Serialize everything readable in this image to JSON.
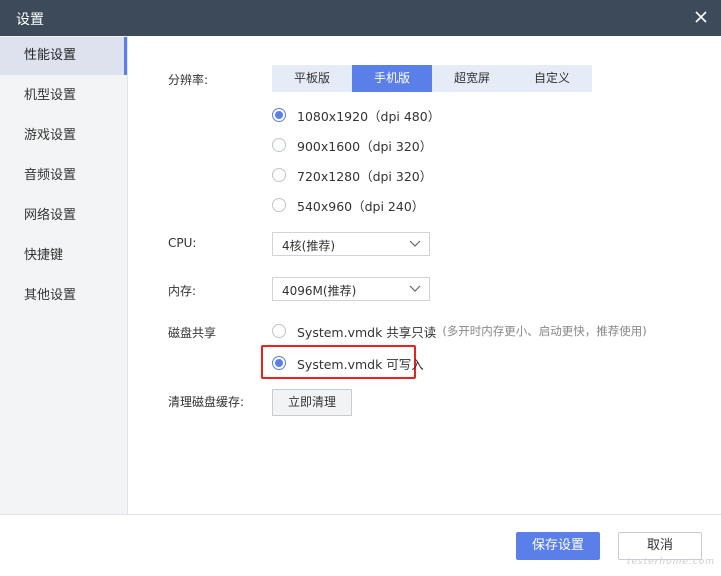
{
  "window": {
    "title": "设置"
  },
  "sidebar": {
    "items": [
      {
        "label": "性能设置",
        "active": true
      },
      {
        "label": "机型设置"
      },
      {
        "label": "游戏设置"
      },
      {
        "label": "音频设置"
      },
      {
        "label": "网络设置"
      },
      {
        "label": "快捷键"
      },
      {
        "label": "其他设置"
      }
    ]
  },
  "resolution": {
    "label": "分辨率:",
    "tabs": [
      "平板版",
      "手机版",
      "超宽屏",
      "自定义"
    ],
    "active_tab": "手机版",
    "options": [
      "1080x1920（dpi 480）",
      "900x1600（dpi 320）",
      "720x1280（dpi 320）",
      "540x960（dpi 240）"
    ],
    "selected": "1080x1920（dpi 480）"
  },
  "cpu": {
    "label": "CPU:",
    "value": "4核(推荐)"
  },
  "memory": {
    "label": "内存:",
    "value": "4096M(推荐)"
  },
  "disk_share": {
    "label": "磁盘共享",
    "options": [
      {
        "text": "System.vmdk 共享只读",
        "hint": "(多开时内存更小、启动更快，推荐使用)"
      },
      {
        "text": "System.vmdk 可写入",
        "hint": ""
      }
    ],
    "selected": "System.vmdk 可写入"
  },
  "clear_cache": {
    "label": "清理磁盘缓存:",
    "button": "立即清理"
  },
  "footer": {
    "save": "保存设置",
    "cancel": "取消"
  },
  "watermark": "testerhome.com",
  "colors": {
    "accent": "#5b7fe8",
    "titlebar": "#3c4a5a",
    "highlight": "#e8231b"
  }
}
